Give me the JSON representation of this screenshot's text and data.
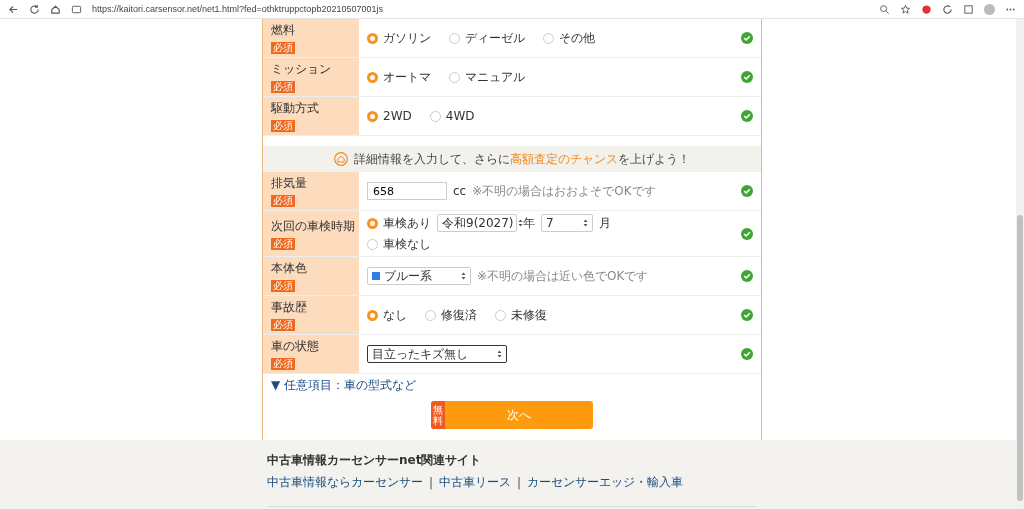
{
  "browser": {
    "url": "https://kaitori.carsensor.net/net1.html?fed=othktruppctopb20210507001js"
  },
  "basic_rows": [
    {
      "label": "燃料",
      "badge": "必須",
      "kind": "radio",
      "valid": true,
      "options": [
        {
          "label": "ガソリン",
          "selected": true
        },
        {
          "label": "ディーゼル",
          "selected": false
        },
        {
          "label": "その他",
          "selected": false
        }
      ]
    },
    {
      "label": "ミッション",
      "badge": "必須",
      "kind": "radio",
      "valid": true,
      "options": [
        {
          "label": "オートマ",
          "selected": true
        },
        {
          "label": "マニュアル",
          "selected": false
        }
      ]
    },
    {
      "label": "駆動方式",
      "badge": "必須",
      "kind": "radio",
      "valid": true,
      "options": [
        {
          "label": "2WD",
          "selected": true
        },
        {
          "label": "4WD",
          "selected": false
        }
      ]
    }
  ],
  "banner": {
    "text": "詳細情報を入力して、さらに**高額査定のチャンス**を上げよう！"
  },
  "detail_rows": [
    {
      "label": "排気量",
      "badge": "必須",
      "kind": "text",
      "valid": true,
      "value": "658",
      "unit": "cc",
      "note": "※不明の場合はおおよそでOKです"
    },
    {
      "label": "次回の車検時期",
      "badge": "必須",
      "kind": "inspection",
      "valid": true,
      "options": [
        {
          "label": "車検あり",
          "selected": true
        },
        {
          "label": "車検なし",
          "selected": false
        }
      ],
      "year": "令和9(2027)",
      "year_unit": "年",
      "month": "7",
      "month_unit": "月"
    },
    {
      "label": "本体色",
      "badge": "必須",
      "kind": "color-select",
      "valid": true,
      "value": "ブルー系",
      "color": "#2f7fe6",
      "note": "※不明の場合は近い色でOKです"
    },
    {
      "label": "事故歴",
      "badge": "必須",
      "kind": "radio",
      "valid": true,
      "options": [
        {
          "label": "なし",
          "selected": true
        },
        {
          "label": "修復済",
          "selected": false
        },
        {
          "label": "未修復",
          "selected": false
        }
      ]
    },
    {
      "label": "車の状態",
      "badge": "必須",
      "kind": "select",
      "valid": true,
      "value": "目立ったキズ無し",
      "focused": true
    }
  ],
  "more_link": "▼ 任意項目：車の型式など",
  "next_button": {
    "badge": "無料",
    "label": "次へ"
  },
  "footer": {
    "title": "中古車情報カーセンサーnet関連サイト",
    "separator": "|",
    "links": [
      "中古車情報ならカーセンサー",
      "中古車リース",
      "カーセンサーエッジ・輸入車"
    ]
  }
}
